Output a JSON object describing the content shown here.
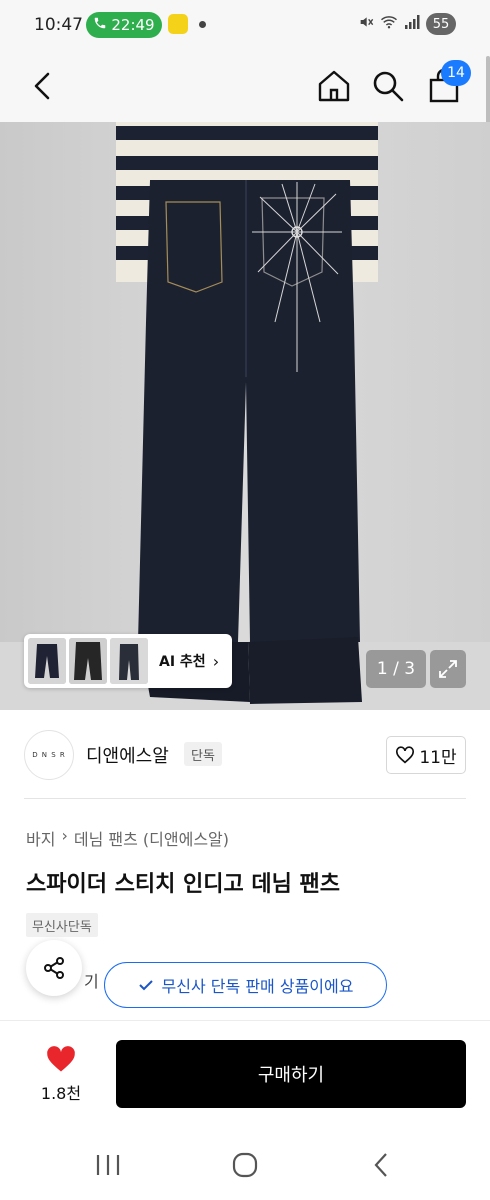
{
  "status_bar": {
    "time": "10:47",
    "call_time": "22:49",
    "battery": "55"
  },
  "nav": {
    "cart_badge": "14"
  },
  "gallery": {
    "ai_label": "AI 추천",
    "counter": "1 / 3"
  },
  "brand": {
    "logo_text": "D N S R",
    "name": "디앤에스알",
    "badge": "단독",
    "likes": "11만"
  },
  "breadcrumb": {
    "category": "바지",
    "sub": "데님 팬츠 (디앤에스알)"
  },
  "product": {
    "title": "스파이더 스티치 인디고 데님 팬츠",
    "tag": "무신사단독",
    "partial_text": "기"
  },
  "toast": {
    "text": "무신사 단독 판매 상품이에요"
  },
  "bottom_bar": {
    "wish_count": "1.8천",
    "buy_label": "구매하기"
  },
  "colors": {
    "accent_blue": "#1a7bff",
    "heart_red": "#e8262c",
    "call_green": "#2fae4e"
  }
}
